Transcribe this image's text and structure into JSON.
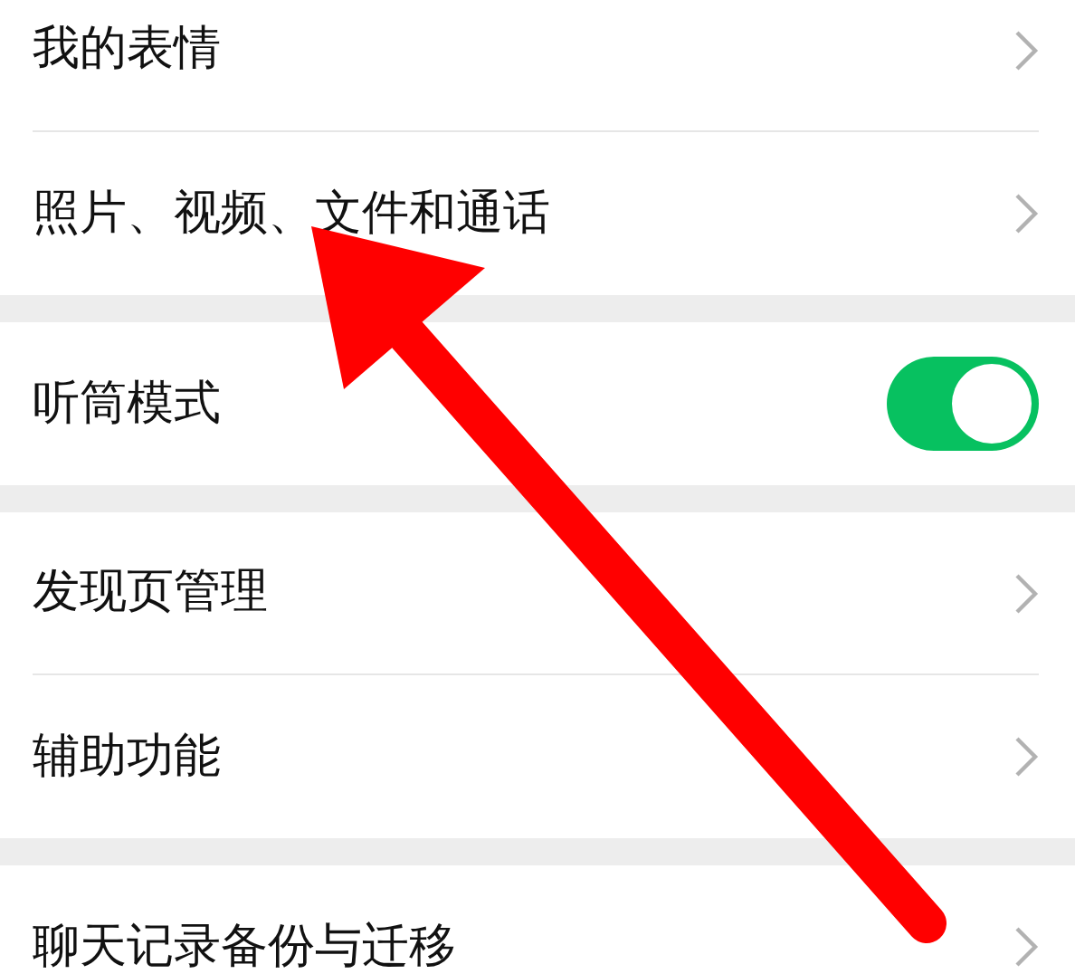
{
  "groups": [
    {
      "rows": [
        {
          "label": "我的表情",
          "kind": "link"
        },
        {
          "label": "照片、视频、文件和通话",
          "kind": "link"
        }
      ]
    },
    {
      "rows": [
        {
          "label": "听筒模式",
          "kind": "toggle",
          "on": true
        }
      ]
    },
    {
      "rows": [
        {
          "label": "发现页管理",
          "kind": "link"
        },
        {
          "label": "辅助功能",
          "kind": "link"
        }
      ]
    },
    {
      "rows": [
        {
          "label": "聊天记录备份与迁移",
          "kind": "link"
        }
      ]
    }
  ]
}
